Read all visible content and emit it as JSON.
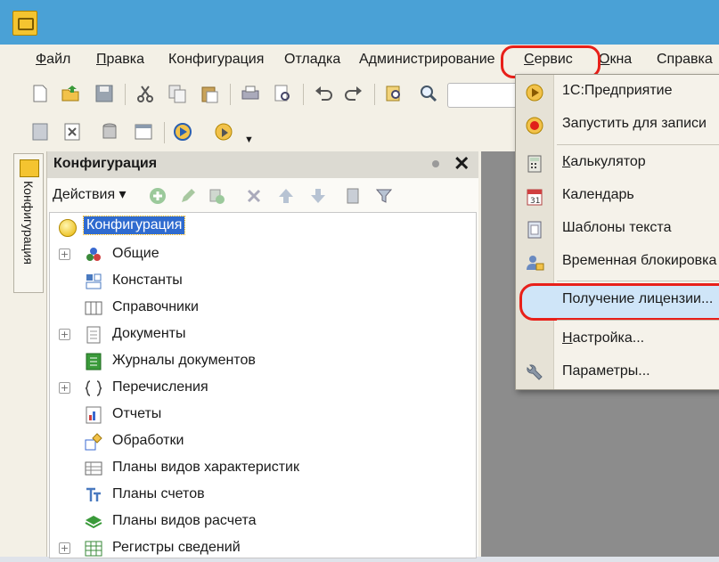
{
  "menubar": {
    "items": [
      {
        "label": "Файл",
        "underline": "Ф",
        "rest": "айл"
      },
      {
        "label": "Правка",
        "underline": "П",
        "rest": "равка"
      },
      {
        "label": "Конфигурация"
      },
      {
        "label": "Отладка"
      },
      {
        "label": "Администрирование"
      },
      {
        "label": "Сервис",
        "underline": "С",
        "rest": "ервис"
      },
      {
        "label": "Окна",
        "underline": "О",
        "rest": "кна"
      },
      {
        "label": "Справка"
      }
    ]
  },
  "panel": {
    "title": "Конфигурация",
    "close_glyph": "✕",
    "actions_label": "Действия ▾",
    "side_tab_label": "Конфигурация"
  },
  "tree": {
    "root": "Конфигурация",
    "items": [
      {
        "label": "Общие",
        "icon": "common-icon",
        "expandable": true
      },
      {
        "label": "Константы",
        "icon": "constants-icon",
        "expandable": false
      },
      {
        "label": "Справочники",
        "icon": "catalogs-icon",
        "expandable": false
      },
      {
        "label": "Документы",
        "icon": "documents-icon",
        "expandable": true
      },
      {
        "label": "Журналы документов",
        "icon": "journals-icon",
        "expandable": false
      },
      {
        "label": "Перечисления",
        "icon": "enums-icon",
        "expandable": true
      },
      {
        "label": "Отчеты",
        "icon": "reports-icon",
        "expandable": false
      },
      {
        "label": "Обработки",
        "icon": "processings-icon",
        "expandable": false
      },
      {
        "label": "Планы видов характеристик",
        "icon": "characteristics-icon",
        "expandable": false
      },
      {
        "label": "Планы счетов",
        "icon": "accounts-icon",
        "expandable": false
      },
      {
        "label": "Планы видов расчета",
        "icon": "calculation-icon",
        "expandable": false
      },
      {
        "label": "Регистры сведений",
        "icon": "registers-icon",
        "expandable": true
      }
    ]
  },
  "service_menu": {
    "items": [
      {
        "label": "1С:Предприятие",
        "icon": "play-icon"
      },
      {
        "label": "Запустить для записи",
        "icon": "record-icon"
      },
      {
        "label": "Калькулятор",
        "icon": "calculator-icon",
        "underline": "К",
        "rest": "алькулятор"
      },
      {
        "label": "Календарь",
        "icon": "calendar-icon"
      },
      {
        "label": "Шаблоны текста",
        "icon": "templates-icon"
      },
      {
        "label": "Временная блокировка",
        "icon": "lock-user-icon"
      },
      {
        "label": "Получение лицензии...",
        "icon": ""
      },
      {
        "label": "Настройка...",
        "icon": "",
        "underline": "Н",
        "rest": "астройка..."
      },
      {
        "label": "Параметры...",
        "icon": "wrench-icon"
      }
    ]
  },
  "colors": {
    "titlebar": "#4aa1d6",
    "highlight_ring": "#e8201a",
    "selection": "#2f6bcf"
  }
}
